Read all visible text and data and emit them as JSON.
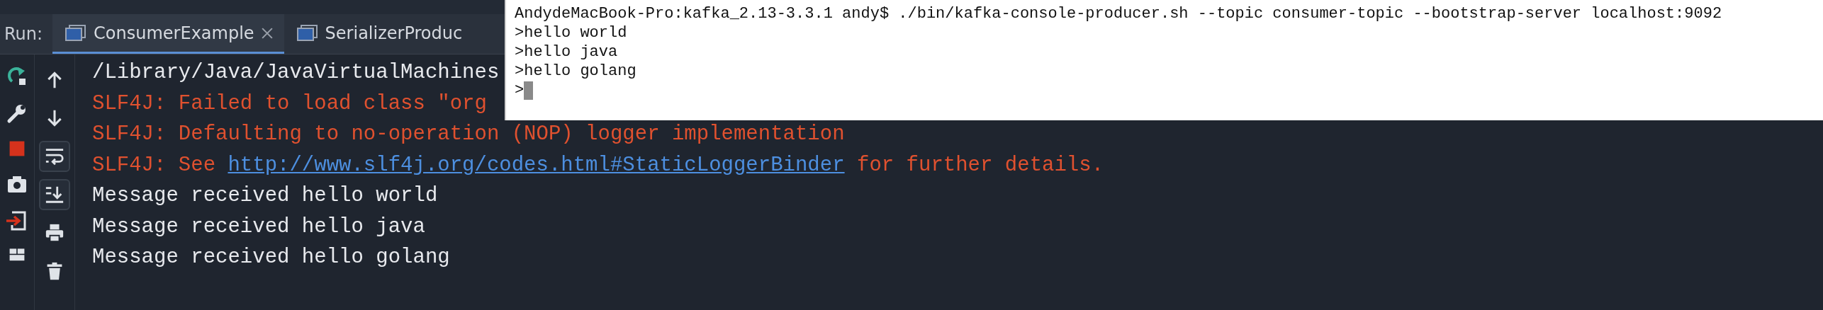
{
  "run_panel": {
    "label": "Run:",
    "tabs": [
      {
        "label": "ConsumerExample",
        "selected": true,
        "closable": true
      },
      {
        "label": "SerializerProduc",
        "selected": false,
        "closable": false
      }
    ]
  },
  "toolbar_secondary": [
    {
      "on": false
    },
    {
      "on": false
    },
    {
      "on": true
    },
    {
      "on": true
    },
    {
      "on": false
    },
    {
      "on": false
    }
  ],
  "console": {
    "lines": [
      {
        "kind": "plain",
        "text": "/Library/Java/JavaVirtualMachines"
      },
      {
        "kind": "error",
        "text": "SLF4J: Failed to load class \"org"
      },
      {
        "kind": "error",
        "text": "SLF4J: Defaulting to no-operation (NOP) logger implementation"
      },
      {
        "kind": "error",
        "text": "SLF4J: See ",
        "link": "http://www.slf4j.org/codes.html#StaticLoggerBinder",
        "after": " for further details."
      },
      {
        "kind": "plain",
        "text": "Message received hello world"
      },
      {
        "kind": "plain",
        "text": "Message received hello java"
      },
      {
        "kind": "plain",
        "text": "Message received hello golang"
      }
    ]
  },
  "terminal": {
    "lines": [
      "AndydeMacBook-Pro:kafka_2.13-3.3.1 andy$ ./bin/kafka-console-producer.sh --topic consumer-topic --bootstrap-server localhost:9092",
      ">hello world",
      ">hello java",
      ">hello golang",
      ">"
    ],
    "cursor": true
  }
}
